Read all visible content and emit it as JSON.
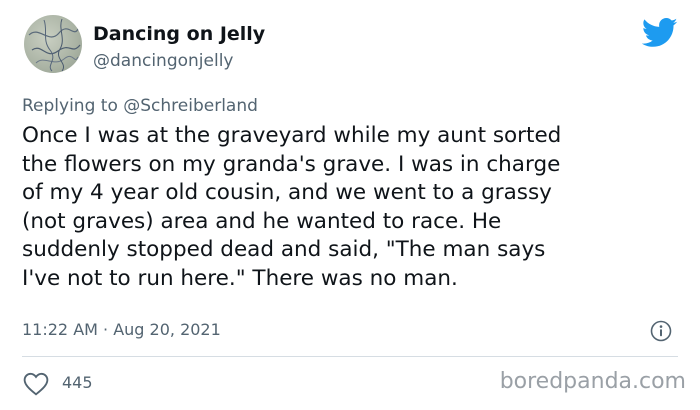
{
  "author": {
    "display_name": "Dancing on Jelly",
    "handle": "@dancingonjelly"
  },
  "reply": {
    "prefix": "Replying to",
    "mention": "@Schreiberland"
  },
  "tweet": {
    "lines": [
      "Once I was at the graveyard while my aunt sorted",
      "the flowers on my granda's grave. I was in charge",
      "of my 4 year old cousin, and we went to a grassy",
      "(not graves) area and he wanted to race. He",
      "suddenly stopped dead and said, \"The man says",
      "I've not to run here.\" There was no man."
    ],
    "timestamp": "11:22 AM · Aug 20, 2021"
  },
  "engagement": {
    "likes": "445"
  },
  "watermark": "boredpanda.com",
  "icons": {
    "brand": "twitter-bird-icon",
    "info": "info-icon",
    "like": "heart-icon"
  },
  "colors": {
    "twitter_blue": "#1d9bf0",
    "text_primary": "#0f1419",
    "text_secondary": "#536471"
  }
}
